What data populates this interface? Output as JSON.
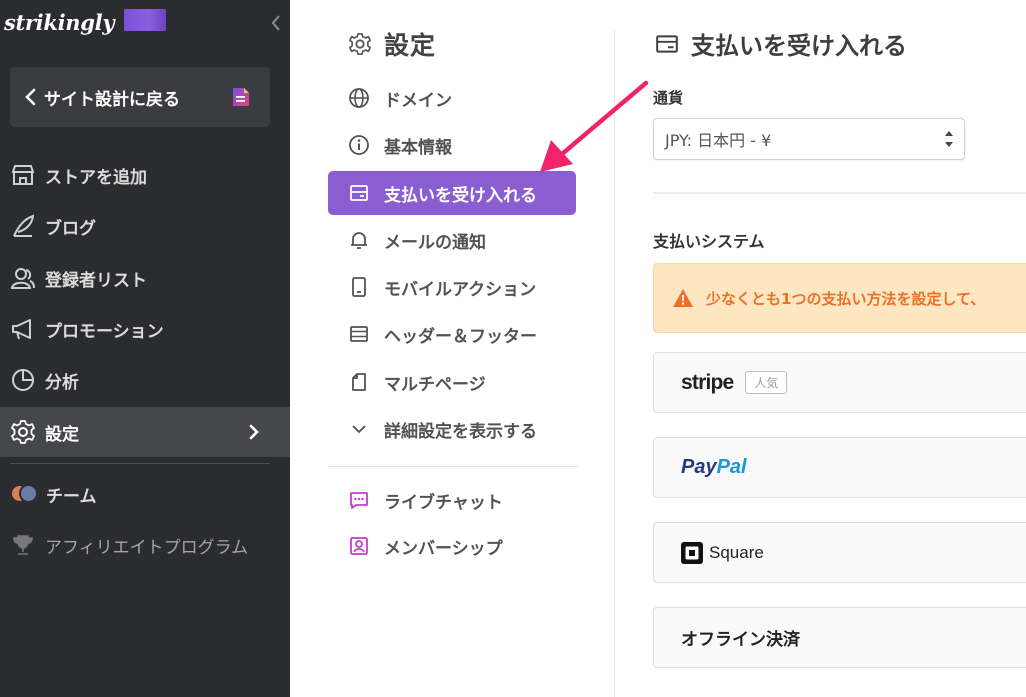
{
  "sidebar": {
    "brand": "strikingly",
    "back_label": "サイト設計に戻る",
    "items": [
      {
        "label": "ストアを追加"
      },
      {
        "label": "ブログ"
      },
      {
        "label": "登録者リスト"
      },
      {
        "label": "プロモーション"
      },
      {
        "label": "分析"
      },
      {
        "label": "設定"
      },
      {
        "label": "チーム"
      },
      {
        "label": "アフィリエイトプログラム"
      }
    ]
  },
  "settings_menu": {
    "title": "設定",
    "items": [
      {
        "label": "ドメイン"
      },
      {
        "label": "基本情報"
      },
      {
        "label": "支払いを受け入れる"
      },
      {
        "label": "メールの通知"
      },
      {
        "label": "モバイルアクション"
      },
      {
        "label": "ヘッダー＆フッター"
      },
      {
        "label": "マルチページ"
      },
      {
        "label": "詳細設定を表示する"
      },
      {
        "label": "ライブチャット"
      },
      {
        "label": "メンバーシップ"
      }
    ]
  },
  "main": {
    "title": "支払いを受け入れる",
    "currency_label": "通貨",
    "currency_value": "JPY: 日本円 - ¥",
    "system_label": "支払いシステム",
    "warning": "少なくとも1つの支払い方法を設定して、",
    "providers": {
      "stripe": "stripe",
      "stripe_badge": "人気",
      "paypal_a": "Pay",
      "paypal_b": "Pal",
      "square": "Square",
      "offline": "オフライン決済"
    }
  },
  "colors": {
    "sidebar_bg": "#2b2c2f",
    "accent_purple": "#8a5dd1",
    "warning_bg": "#fde7c2",
    "warning_text": "#f06f26",
    "annotation_arrow": "#f0246b"
  }
}
